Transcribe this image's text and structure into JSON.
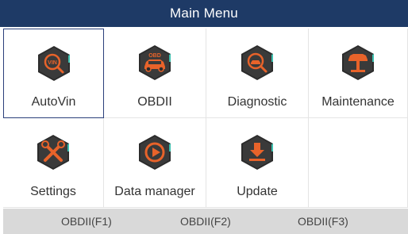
{
  "header": {
    "title": "Main Menu"
  },
  "menu": {
    "items": [
      {
        "label": "AutoVin",
        "icon": "vin-magnifier-icon"
      },
      {
        "label": "OBDII",
        "icon": "obd-car-icon"
      },
      {
        "label": "Diagnostic",
        "icon": "diagnostic-magnifier-icon"
      },
      {
        "label": "Maintenance",
        "icon": "car-lift-icon"
      },
      {
        "label": "Settings",
        "icon": "tools-icon"
      },
      {
        "label": "Data manager",
        "icon": "play-icon"
      },
      {
        "label": "Update",
        "icon": "download-icon"
      }
    ],
    "selected_index": 0
  },
  "fkeys": [
    {
      "label": "OBDII(F1)"
    },
    {
      "label": "OBDII(F2)"
    },
    {
      "label": "OBDII(F3)"
    }
  ],
  "colors": {
    "header_bg": "#1e3a66",
    "icon_hex_dark": "#2b2b2b",
    "icon_accent_orange": "#e8632a",
    "icon_accent_teal": "#3cc2b0",
    "fkey_bar_bg": "#d9d9d9"
  }
}
